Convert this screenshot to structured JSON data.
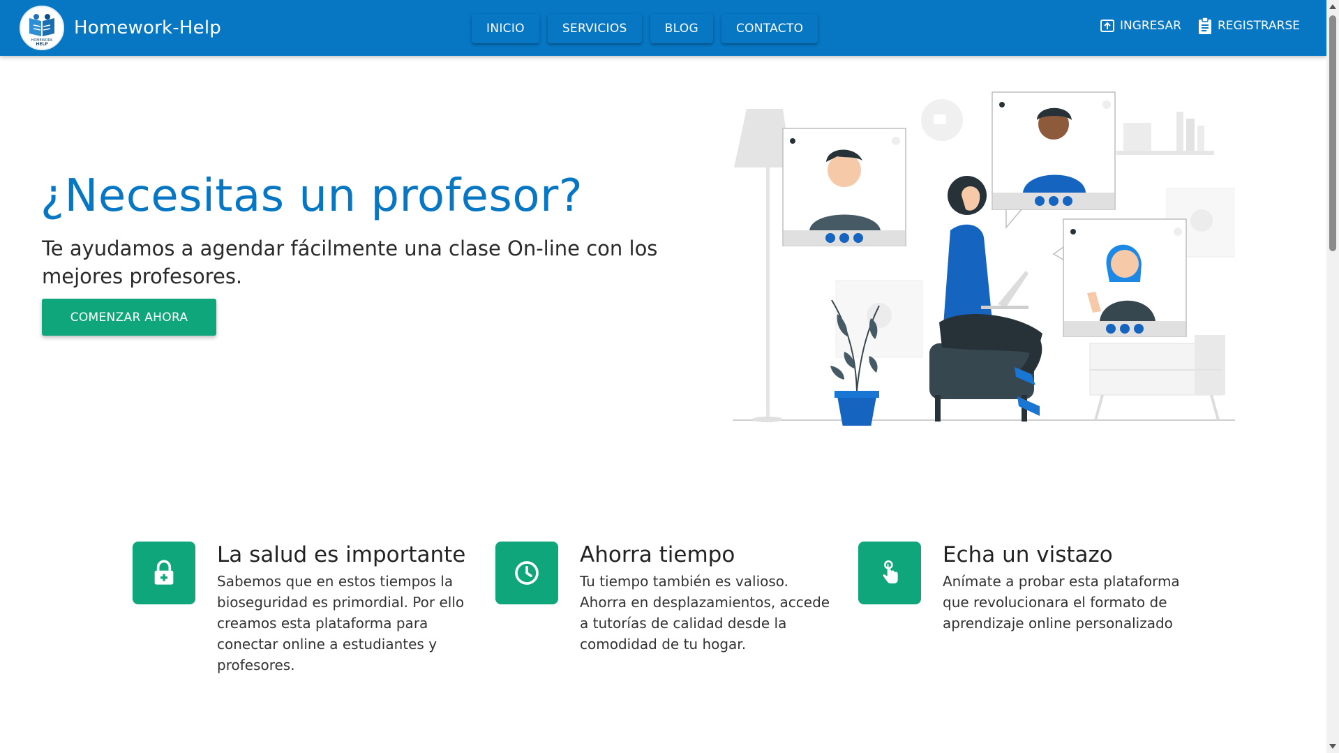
{
  "navbar": {
    "brand": "Homework-Help",
    "logo_text_line1": "HOMEWORK",
    "logo_text_line2": "HELP",
    "links": [
      {
        "label": "INICIO"
      },
      {
        "label": "SERVICIOS"
      },
      {
        "label": "BLOG"
      },
      {
        "label": "CONTACTO"
      }
    ],
    "login_label": "INGRESAR",
    "register_label": "REGISTRARSE"
  },
  "hero": {
    "title": "¿Necesitas un profesor?",
    "subtitle": "Te ayudamos a agendar fácilmente una clase On-line con los mejores profesores.",
    "cta": "COMENZAR AHORA"
  },
  "features": [
    {
      "icon": "lock-plus-icon",
      "title": "La salud es importante",
      "description": "Sabemos que en estos tiempos la bioseguridad es primordial. Por ello creamos esta plataforma para conectar online a estudiantes y profesores."
    },
    {
      "icon": "clock-icon",
      "title": "Ahorra tiempo",
      "description": "Tu tiempo también es valioso. Ahorra en desplazamientos, accede a tutorías de calidad desde la comodidad de tu hogar."
    },
    {
      "icon": "tap-hand-icon",
      "title": "Echa un vistazo",
      "description": "Anímate a probar esta plataforma que revolucionara el formato de aprendizaje online personalizado"
    }
  ],
  "colors": {
    "primary": "#0777c4",
    "accent": "#0ea67a",
    "text": "#222222"
  }
}
